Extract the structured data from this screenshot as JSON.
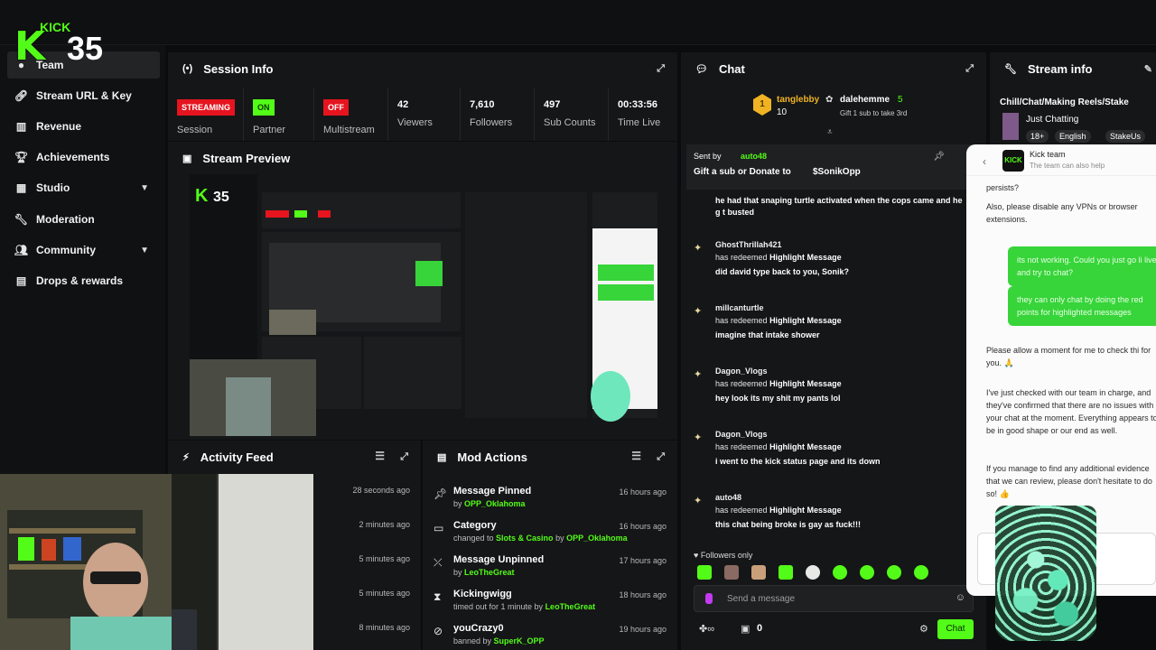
{
  "logo": {
    "kick": "KICK",
    "number": "35"
  },
  "sidebar": {
    "items": [
      {
        "label": "Team",
        "icon": "team-icon"
      },
      {
        "label": "Stream URL & Key",
        "icon": "link-icon"
      },
      {
        "label": "Revenue",
        "icon": "chart-icon"
      },
      {
        "label": "Achievements",
        "icon": "trophy-icon"
      },
      {
        "label": "Studio",
        "icon": "studio-icon"
      },
      {
        "label": "Moderation",
        "icon": "wrench-icon"
      },
      {
        "label": "Community",
        "icon": "people-icon"
      },
      {
        "label": "Drops & rewards",
        "icon": "drops-icon"
      }
    ]
  },
  "session": {
    "title": "Session Info",
    "stats": [
      {
        "badge": "STREAMING",
        "label": "Session"
      },
      {
        "badge": "ON",
        "label": "Partner"
      },
      {
        "badge": "OFF",
        "label": "Multistream"
      },
      {
        "value": "42",
        "label": "Viewers"
      },
      {
        "value": "7,610",
        "label": "Followers"
      },
      {
        "value": "497",
        "label": "Sub Counts"
      },
      {
        "value": "00:33:56",
        "label": "Time Live"
      }
    ]
  },
  "preview": {
    "title": "Stream Preview"
  },
  "activity": {
    "title": "Activity Feed",
    "times": [
      "28 seconds ago",
      "2 minutes ago",
      "5 minutes ago",
      "5 minutes ago",
      "8 minutes ago"
    ]
  },
  "mod": {
    "title": "Mod Actions",
    "rows": [
      {
        "title": "Message Pinned",
        "pre": "by ",
        "user": "OPP_Oklahoma",
        "mid": "",
        "user2": "",
        "time": "16 hours ago",
        "icon": "pin-icon"
      },
      {
        "title": "Category",
        "pre": "changed to ",
        "user": "Slots & Casino",
        "mid": " by ",
        "user2": "OPP_Oklahoma",
        "time": "16 hours ago",
        "icon": "category-icon"
      },
      {
        "title": "Message Unpinned",
        "pre": "by ",
        "user": "LeoTheGreat",
        "mid": "",
        "user2": "",
        "time": "17 hours ago",
        "icon": "unpin-icon"
      },
      {
        "title": "Kickingwigg",
        "pre": "timed out for 1 minute by ",
        "user": "LeoTheGreat",
        "mid": "",
        "user2": "",
        "time": "18 hours ago",
        "icon": "hourglass-icon"
      },
      {
        "title": "youCrazy0",
        "pre": "banned by ",
        "user": "SuperK_OPP",
        "mid": "",
        "user2": "",
        "time": "19 hours ago",
        "icon": "ban-icon"
      }
    ]
  },
  "chat": {
    "title": "Chat",
    "top_gifter": {
      "name": "tanglebby",
      "count": "10",
      "rank": "1"
    },
    "gifter2": {
      "name": "dalehemme",
      "count": "5",
      "note": "Gift 1 sub to take 3rd"
    },
    "pinned": {
      "sent_by": "Sent by",
      "user": "auto48",
      "text": "Gift a sub or Donate to",
      "target": "$SonikOpp"
    },
    "partial": "he had that snaping turtle activated when the cops came and he g t busted",
    "messages": [
      {
        "user": "GhostThrillah421",
        "redeem": "has redeemed",
        "reward": "Highlight Message",
        "text": "did david type back to you, Sonik?"
      },
      {
        "user": "millcanturtle",
        "redeem": "has redeemed",
        "reward": "Highlight Message",
        "text": "imagine that intake shower"
      },
      {
        "user": "Dagon_Vlogs",
        "redeem": "has redeemed",
        "reward": "Highlight Message",
        "text": "hey look its my shit my pants lol"
      },
      {
        "user": "Dagon_Vlogs",
        "redeem": "has redeemed",
        "reward": "Highlight Message",
        "text": "i went to the kick status page and its down"
      },
      {
        "user": "auto48",
        "redeem": "has redeemed",
        "reward": "Highlight Message",
        "text": "this chat being broke is gay as fuck!!!"
      }
    ],
    "followers_only": "Followers only",
    "placeholder": "Send a message",
    "count_zero": "0",
    "chat_button": "Chat"
  },
  "stream_info": {
    "title": "Stream info",
    "stream_title": "Chill/Chat/Making Reels/Stake",
    "category": "Just Chatting",
    "tags": [
      "18+",
      "English",
      "StakeUs"
    ]
  },
  "help": {
    "team": "Kick team",
    "sub": "The team can also help",
    "p1": "persists?",
    "p2": "Also, please disable any VPNs or browser extensions.",
    "b1": "its not working. Could you just go li live and try to chat?",
    "b2": "they can only chat by doing the red points for highlighted messages",
    "p3": "Please allow a moment for me to check thi for you. 🙏",
    "p4": "I've just checked with our team in charge, and they've confirmed that there are no issues with your chat at the moment. Everything appears to be in good shape or our end as well.",
    "p5": "If you manage to find any additional evidence that we can review, please don't hesitate to do so! 👍"
  }
}
